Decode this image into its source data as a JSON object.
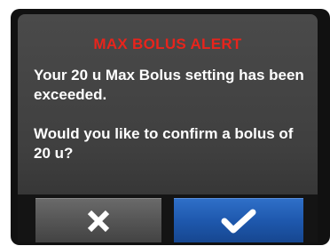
{
  "alert": {
    "title": "MAX BOLUS ALERT",
    "message_line1": "Your 20 u Max Bolus setting has been exceeded.",
    "message_line2": "Would you like to confirm a bolus of 20 u?"
  },
  "buttons": {
    "cancel_icon": "x-icon",
    "confirm_icon": "checkmark-icon"
  },
  "colors": {
    "title": "#e8241c",
    "confirm_button": "#1e58ad",
    "cancel_button": "#555555"
  }
}
